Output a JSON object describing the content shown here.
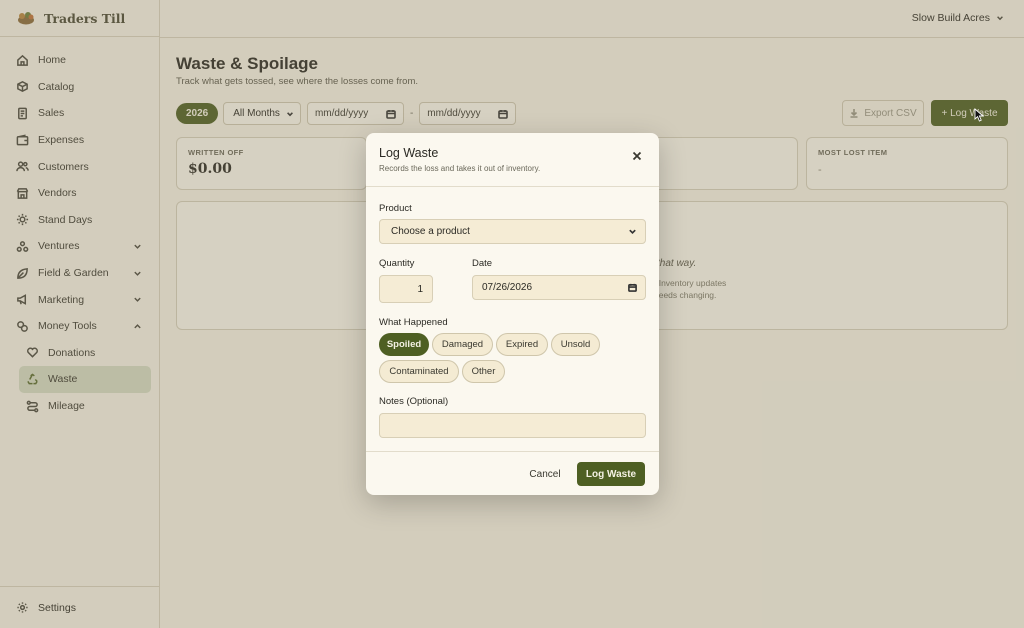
{
  "app": {
    "name": "Traders Till"
  },
  "account": {
    "name": "Slow Build Acres"
  },
  "sidebar": {
    "items": [
      {
        "label": "Home"
      },
      {
        "label": "Catalog"
      },
      {
        "label": "Sales"
      },
      {
        "label": "Expenses"
      },
      {
        "label": "Customers"
      },
      {
        "label": "Vendors"
      },
      {
        "label": "Stand Days"
      },
      {
        "label": "Ventures"
      },
      {
        "label": "Field & Garden"
      },
      {
        "label": "Marketing"
      },
      {
        "label": "Money Tools"
      }
    ],
    "subitems": [
      {
        "label": "Donations"
      },
      {
        "label": "Waste"
      },
      {
        "label": "Mileage"
      }
    ],
    "settings_label": "Settings"
  },
  "page": {
    "title": "Waste & Spoilage",
    "subtitle": "Track what gets tossed, see where the losses come from.",
    "filters": {
      "year": "2026",
      "month": "All Months",
      "date_from_placeholder": "mm/dd/yyyy",
      "date_to_placeholder": "mm/dd/yyyy",
      "separator": "-"
    },
    "export_label": "Export CSV",
    "log_label": "+ Log Waste",
    "stats": [
      {
        "label": "WRITTEN OFF",
        "value": "$0.00"
      },
      {
        "label": "MOST LOST ITEM",
        "value": "-"
      }
    ],
    "empty_visible_fragment": "that way.",
    "empty_desc_line1": ". Inventory updates",
    "empty_desc_line2": "needs changing."
  },
  "modal": {
    "title": "Log Waste",
    "subtitle": "Records the loss and takes it out of inventory.",
    "product_label": "Product",
    "product_placeholder": "Choose a product",
    "quantity_label": "Quantity",
    "quantity_value": "1",
    "date_label": "Date",
    "date_value": "07/26/2026",
    "reason_label": "What Happened",
    "reasons": [
      "Spoiled",
      "Damaged",
      "Expired",
      "Unsold",
      "Contaminated",
      "Other"
    ],
    "selected_reason": "Spoiled",
    "notes_label": "Notes (Optional)",
    "notes_value": "",
    "cancel_label": "Cancel",
    "submit_label": "Log Waste"
  },
  "colors": {
    "brand": "#4e5f23",
    "background": "#f6f2e6",
    "input_fill": "#f5ecd5"
  }
}
